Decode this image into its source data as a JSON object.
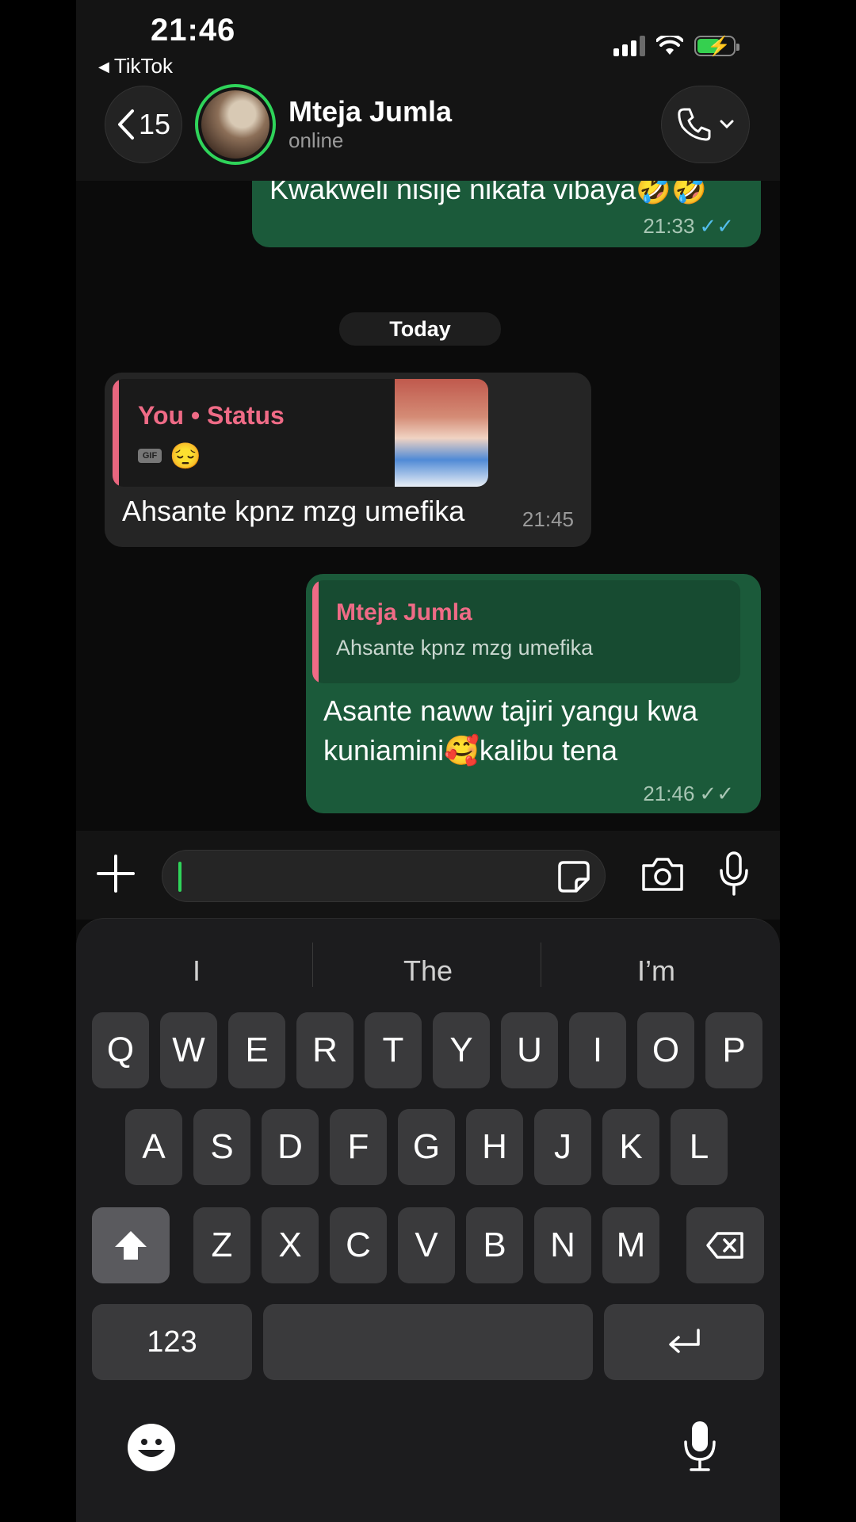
{
  "status_bar": {
    "time": "21:46",
    "back_app": "TikTok"
  },
  "header": {
    "back_count": "15",
    "contact_name": "Mteja Jumla",
    "contact_status": "online"
  },
  "chat": {
    "date_separator": "Today",
    "messages": [
      {
        "direction": "outgoing",
        "text": "Kwakweli nisije nikafa vibaya🤣🤣",
        "time": "21:33",
        "ticks": "✓✓",
        "read": true
      },
      {
        "direction": "incoming",
        "quote_title": "You • Status",
        "quote_badge": "GIF",
        "quote_emoji": "😔",
        "text": "Ahsante kpnz mzg umefika",
        "time": "21:45"
      },
      {
        "direction": "outgoing",
        "quote_title": "Mteja Jumla",
        "quote_text": "Ahsante kpnz mzg umefika",
        "text_line1": "Asante naww tajiri yangu kwa",
        "text_line2": "kuniamini🥰kalibu tena",
        "time": "21:46",
        "ticks": "✓✓",
        "read": false
      }
    ]
  },
  "keyboard": {
    "suggestions": [
      "I",
      "The",
      "I’m"
    ],
    "row1": [
      "Q",
      "W",
      "E",
      "R",
      "T",
      "Y",
      "U",
      "I",
      "O",
      "P"
    ],
    "row2": [
      "A",
      "S",
      "D",
      "F",
      "G",
      "H",
      "J",
      "K",
      "L"
    ],
    "row3": [
      "Z",
      "X",
      "C",
      "V",
      "B",
      "N",
      "M"
    ],
    "numbers_key": "123"
  },
  "colors": {
    "outgoing_bubble": "#1b5a3a",
    "incoming_bubble": "#252525",
    "accent_green": "#2fd45a",
    "quote_pink": "#ef6b86",
    "read_tick": "#53bdeb"
  }
}
